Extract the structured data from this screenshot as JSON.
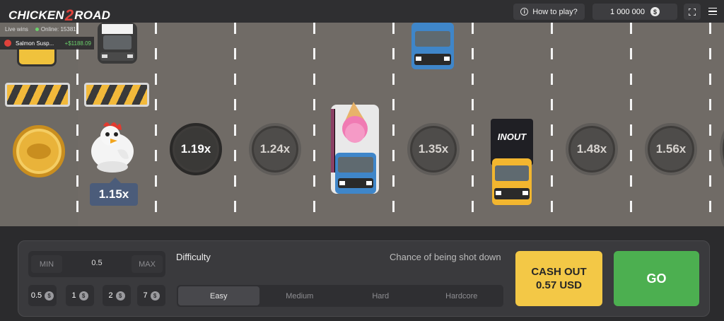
{
  "header": {
    "logo_left": "CHICKEN",
    "logo_mid": "2",
    "logo_right": "ROAD",
    "how_to_play": "How to play?",
    "balance": "1 000 000",
    "currency_symbol": "$"
  },
  "live": {
    "live_wins_label": "Live wins",
    "online_label": "Online: 15381",
    "winner_name": "Salmon Susp...",
    "winner_amount": "+$1188.09"
  },
  "road": {
    "current_multiplier": "1.15x",
    "multipliers": [
      "1.19x",
      "1.24x",
      "1.35x",
      "1.48x",
      "1.56x"
    ],
    "truck_brand": "INOUT"
  },
  "bet": {
    "min_label": "MIN",
    "value": "0.5",
    "max_label": "MAX",
    "quick_bets": [
      "0.5",
      "1",
      "2",
      "7"
    ]
  },
  "difficulty": {
    "label": "Difficulty",
    "chance_label": "Chance of being shot down",
    "options": [
      "Easy",
      "Medium",
      "Hard",
      "Hardcore"
    ],
    "selected": "Easy"
  },
  "actions": {
    "cashout_line1": "CASH OUT",
    "cashout_line2": "0.57 USD",
    "go_label": "GO"
  },
  "colors": {
    "road": "#706b66",
    "cashout": "#f3c846",
    "go": "#4caf50",
    "multiplier_tag": "#4b5c7a"
  }
}
